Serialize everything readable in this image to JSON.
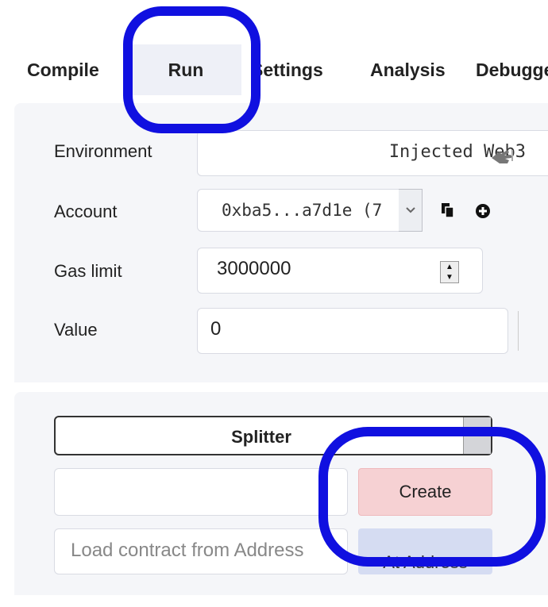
{
  "tabs": [
    {
      "label": "Compile"
    },
    {
      "label": "Run"
    },
    {
      "label": "Settings"
    },
    {
      "label": "Analysis"
    },
    {
      "label": "Debugger"
    }
  ],
  "environment": {
    "label": "Environment",
    "value": "Injected Web3"
  },
  "account": {
    "label": "Account",
    "value": "0xba5...a7d1e (7"
  },
  "gas_limit": {
    "label": "Gas limit",
    "value": "3000000"
  },
  "value": {
    "label": "Value",
    "value": "0"
  },
  "contract": {
    "selected": "Splitter"
  },
  "create": {
    "label": "Create"
  },
  "load": {
    "placeholder": "Load contract from Address"
  },
  "at_address": {
    "label": "At Address"
  },
  "colors": {
    "annotation": "#1010e0",
    "create_bg": "#f6d1d3",
    "at_address_bg": "#d5dcf2",
    "active_tab_bg": "#eef0f7"
  },
  "icons": [
    "copy-icon",
    "plus-circle-icon",
    "pointing-hand-icon",
    "chevron-down-icon",
    "spinner-arrows-icon"
  ]
}
